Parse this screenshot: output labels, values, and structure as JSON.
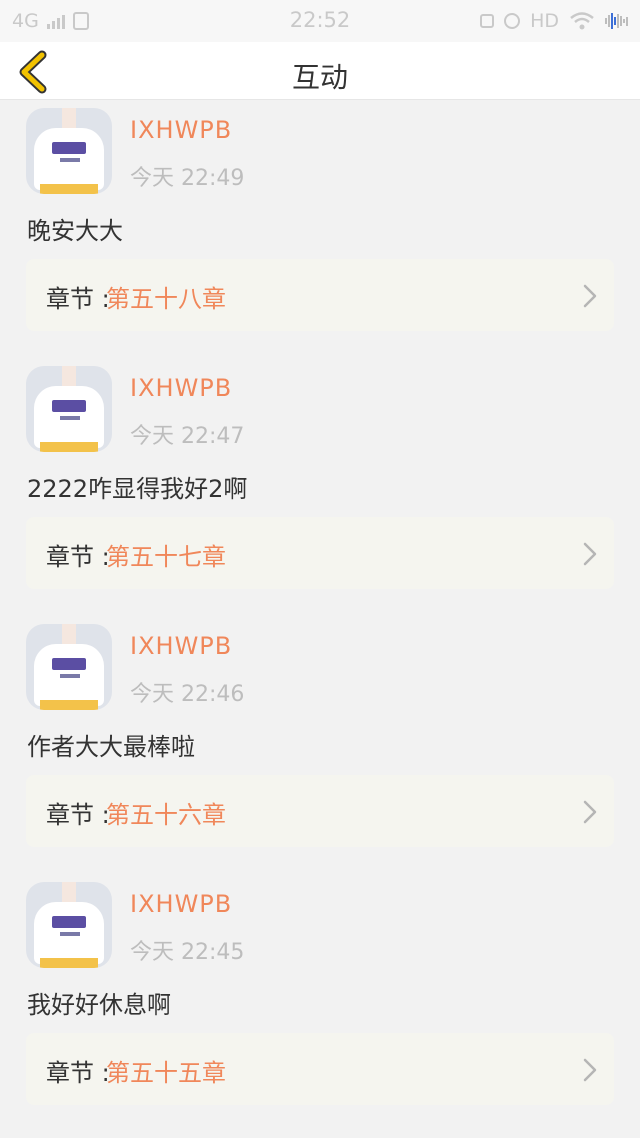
{
  "status_bar": {
    "network": "4G",
    "time": "22:52",
    "hd": "HD"
  },
  "header": {
    "title": "互动"
  },
  "comments": [
    {
      "username": "IXHWPB",
      "time": "今天 22:49",
      "text": "晚安大大",
      "chapter_label": "章节 :",
      "chapter_name": "第五十八章"
    },
    {
      "username": "IXHWPB",
      "time": "今天 22:47",
      "text": "2222咋显得我好2啊",
      "chapter_label": "章节 :",
      "chapter_name": "第五十七章"
    },
    {
      "username": "IXHWPB",
      "time": "今天 22:46",
      "text": "作者大大最棒啦",
      "chapter_label": "章节 :",
      "chapter_name": "第五十六章"
    },
    {
      "username": "IXHWPB",
      "time": "今天 22:45",
      "text": "我好好休息啊",
      "chapter_label": "章节 :",
      "chapter_name": "第五十五章"
    }
  ],
  "colors": {
    "accent": "#f0875a",
    "back_arrow": "#f2c200",
    "card_bg": "#f5f5ef"
  }
}
